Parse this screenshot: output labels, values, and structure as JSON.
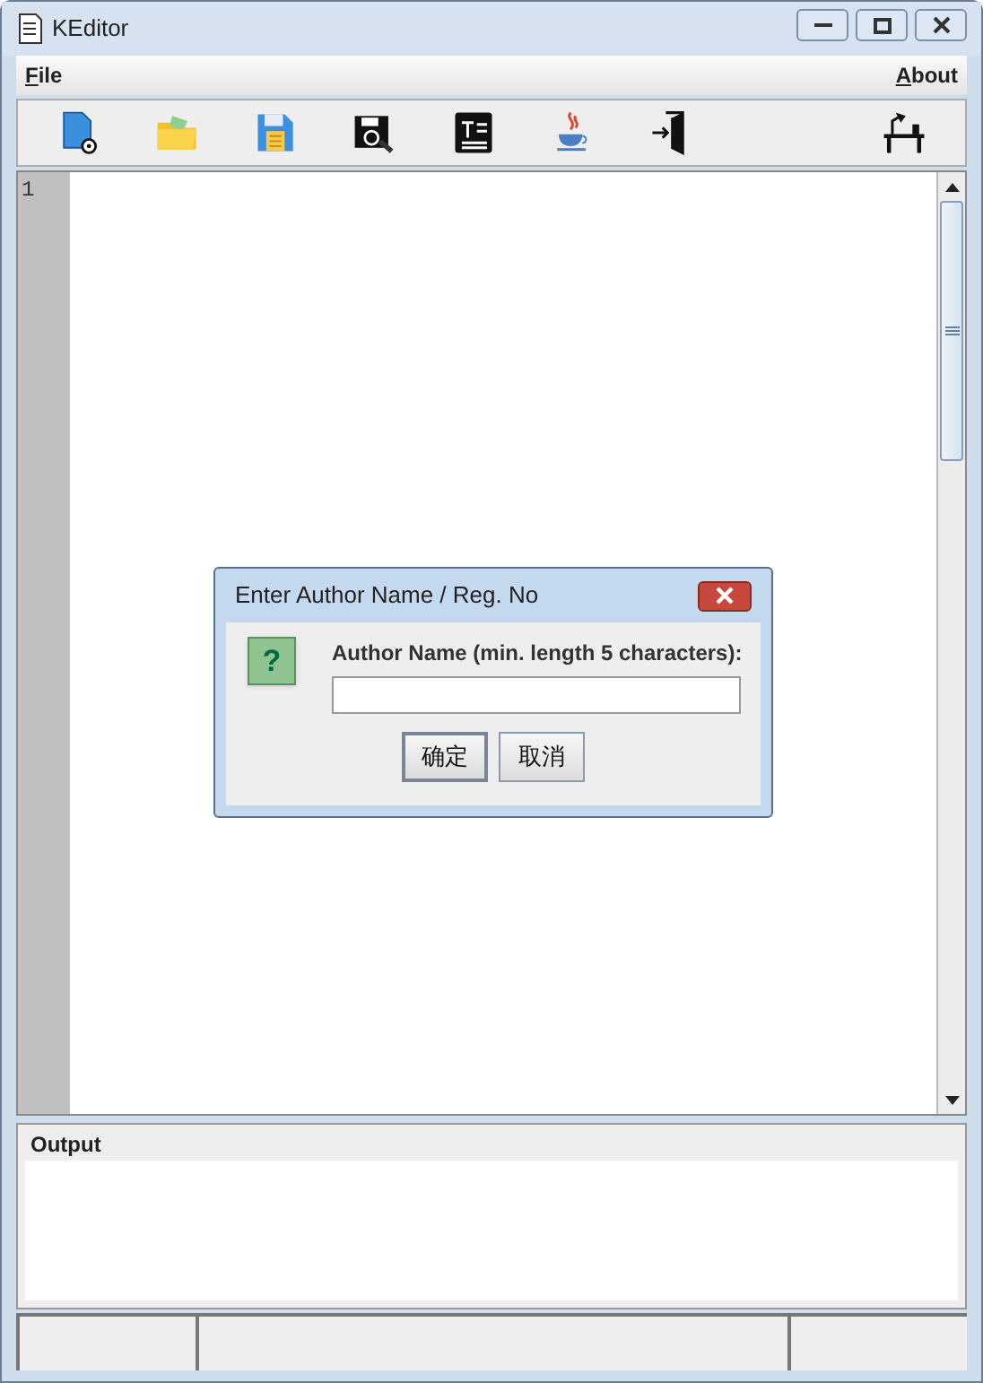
{
  "window": {
    "title": "KEditor"
  },
  "menu": [
    {
      "label": "File"
    },
    {
      "label": "About"
    }
  ],
  "toolbar": [
    {
      "kind": "new"
    },
    {
      "kind": "open"
    },
    {
      "kind": "save"
    },
    {
      "kind": "find"
    },
    {
      "kind": "text"
    },
    {
      "kind": "java"
    },
    {
      "kind": "exit"
    },
    {
      "kind": "desk"
    }
  ],
  "editor": {
    "line_numbers": [
      "1"
    ]
  },
  "dialog": {
    "title": "Enter Author Name / Reg. No",
    "icon": "?",
    "prompt": "Author Name (min. length 5 characters):",
    "buttons": [
      {
        "label": "确定",
        "focused": true
      },
      {
        "label": "取消",
        "focused": false
      }
    ]
  },
  "output": {
    "title": "Output"
  }
}
